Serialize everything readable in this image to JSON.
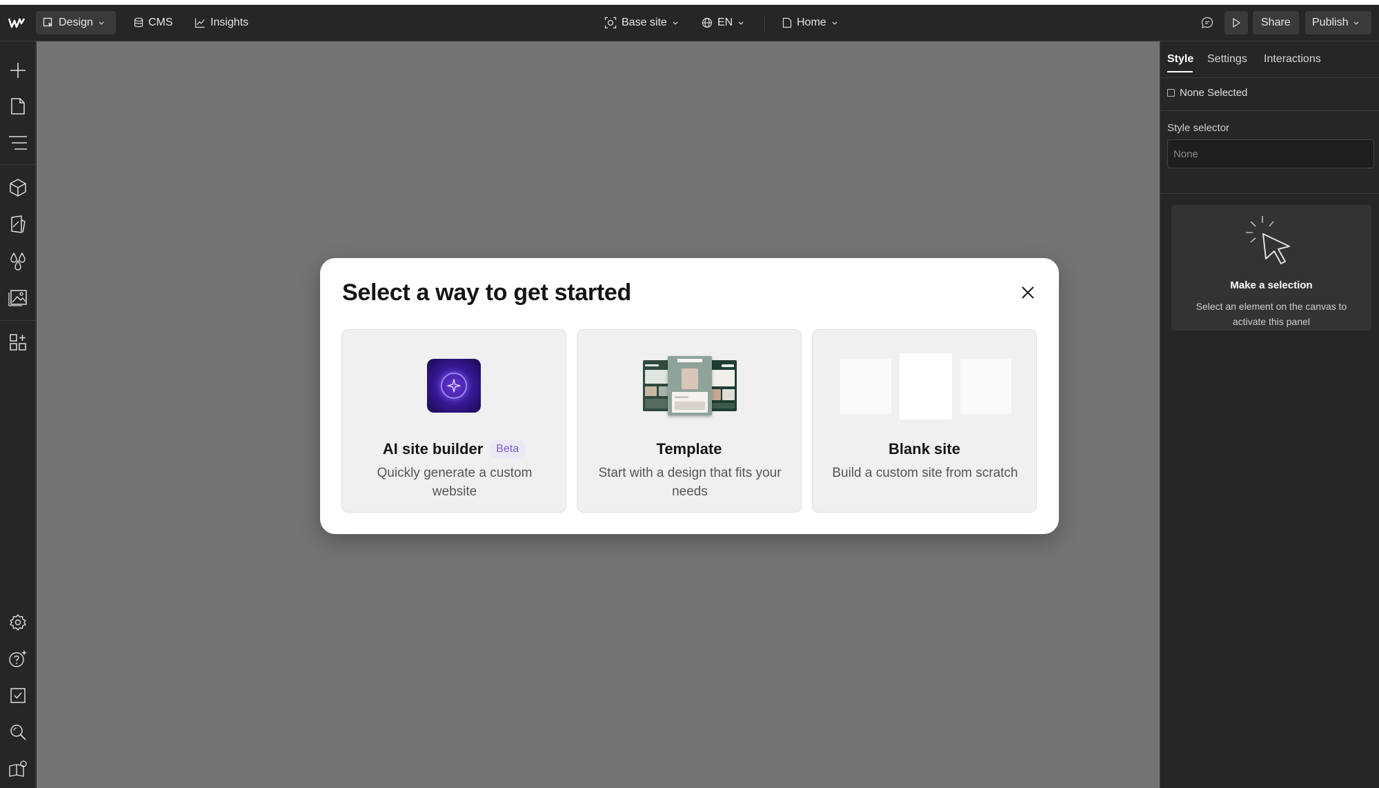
{
  "topbar": {
    "logo_icon": "webflow-logo-icon",
    "design_label": "Design",
    "cms_label": "CMS",
    "insights_label": "Insights",
    "base_site_label": "Base site",
    "locale_label": "EN",
    "page_label": "Home",
    "share_label": "Share",
    "publish_label": "Publish"
  },
  "right_panel": {
    "tabs": [
      "Style",
      "Settings",
      "Interactions"
    ],
    "active_tab": "Style",
    "none_selected": "None Selected",
    "style_selector_label": "Style selector",
    "style_selector_placeholder": "None",
    "empty_title": "Make a selection",
    "empty_text": "Select an element on the canvas to activate this panel"
  },
  "modal": {
    "title": "Select a way to get started",
    "options": [
      {
        "title": "AI site builder",
        "badge": "Beta",
        "description": "Quickly generate a custom website"
      },
      {
        "title": "Template",
        "description": "Start with a design that fits your needs"
      },
      {
        "title": "Blank site",
        "description": "Build a custom site from scratch"
      }
    ]
  },
  "colors": {
    "topbar_bg": "#262626",
    "canvas_bg": "#737373",
    "accent_beta": "#7b5cd6",
    "ai_gradient": "#6a3bd9"
  }
}
